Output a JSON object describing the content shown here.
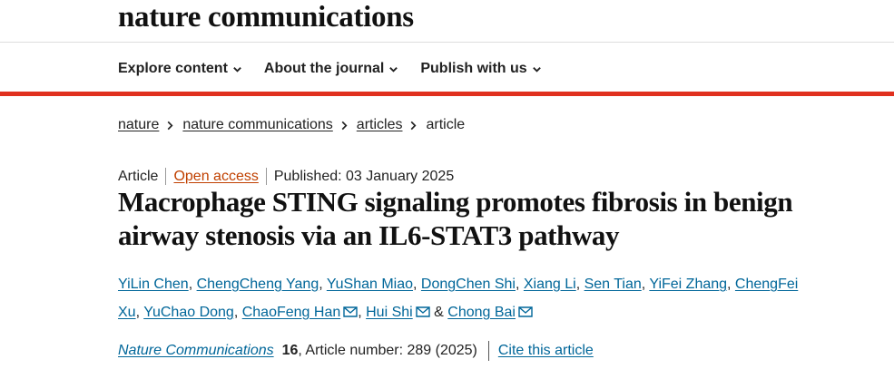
{
  "site": {
    "logo": "nature communications"
  },
  "nav": [
    {
      "label": "Explore content"
    },
    {
      "label": "About the journal"
    },
    {
      "label": "Publish with us"
    }
  ],
  "breadcrumb": {
    "items": [
      {
        "label": "nature"
      },
      {
        "label": "nature communications"
      },
      {
        "label": "articles"
      }
    ],
    "current": "article"
  },
  "article": {
    "type": "Article",
    "access": "Open access",
    "published": "Published: 03 January 2025",
    "title": "Macrophage STING signaling promotes fibrosis in benign airway stenosis via an IL6-STAT3 pathway"
  },
  "authors": [
    {
      "name": "YiLin Chen",
      "sep": ", "
    },
    {
      "name": "ChengCheng Yang",
      "sep": ", "
    },
    {
      "name": "YuShan Miao",
      "sep": ", "
    },
    {
      "name": "DongChen Shi",
      "sep": ", "
    },
    {
      "name": "Xiang Li",
      "sep": ", "
    },
    {
      "name": "Sen Tian",
      "sep": ", "
    },
    {
      "name": "YiFei Zhang",
      "sep": ", "
    },
    {
      "name": "ChengFei Xu",
      "sep": ", "
    },
    {
      "name": "YuChao Dong",
      "sep": ", "
    },
    {
      "name": "ChaoFeng Han",
      "sep": ", ",
      "mail": true
    },
    {
      "name": "Hui Shi",
      "sep": " & ",
      "mail": true
    },
    {
      "name": "Chong Bai",
      "sep": "",
      "mail": true
    }
  ],
  "citation": {
    "journal": "Nature Communications",
    "volume": "16",
    "number": ", Article number: 289 (2025)",
    "cite_label": "Cite this article"
  },
  "colors": {
    "accent_red": "#e0301e",
    "link_blue": "#006699",
    "open_access_orange": "#c04000"
  }
}
